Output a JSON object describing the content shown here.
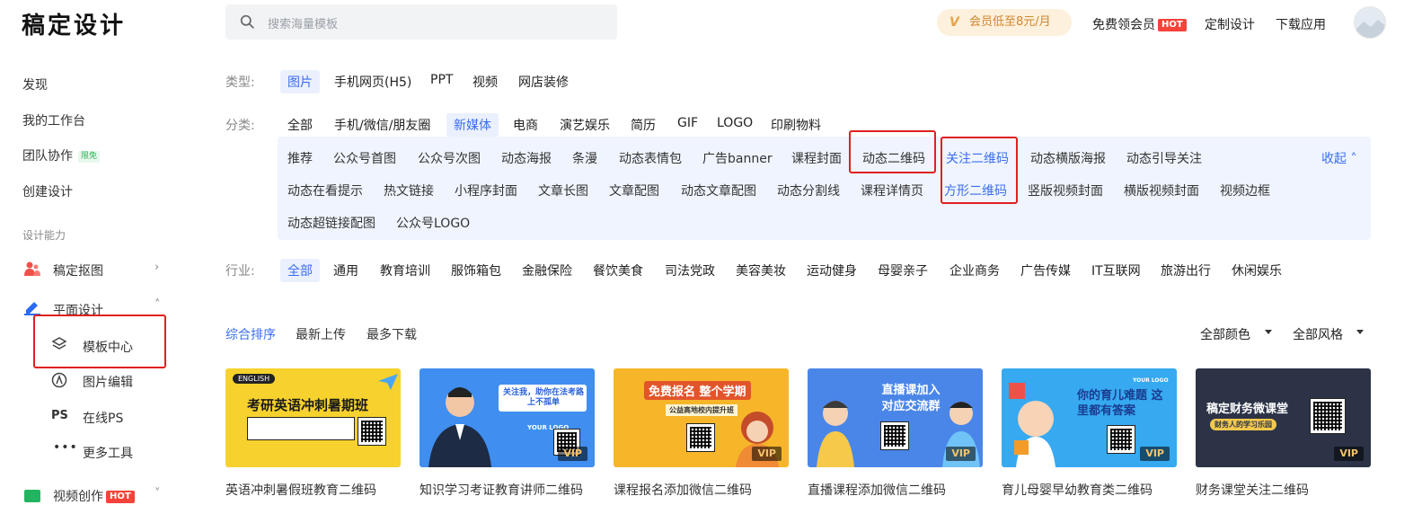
{
  "header": {
    "logo": "稿定设计",
    "search_placeholder": "搜索海量模板",
    "vip_icon": "V",
    "vip_text": "会员低至8元/月",
    "free_vip": "免费领会员",
    "hot": "HOT",
    "custom_design": "定制设计",
    "download_app": "下载应用"
  },
  "sidebar": {
    "discover": "发现",
    "workspace": "我的工作台",
    "team": "团队协作",
    "team_badge": "限免",
    "create": "创建设计",
    "section": "设计能力",
    "cutout": "稿定抠图",
    "graphic": "平面设计",
    "template_center": "模板中心",
    "image_edit": "图片编辑",
    "ps_icon": "PS",
    "online_ps": "在线PS",
    "more_tools": "更多工具",
    "video": "视频创作",
    "video_badge": "HOT"
  },
  "filters": {
    "type_label": "类型:",
    "types": [
      "图片",
      "手机网页(H5)",
      "PPT",
      "视频",
      "网店装修"
    ],
    "category_label": "分类:",
    "categories": [
      "全部",
      "手机/微信/朋友圈",
      "新媒体",
      "电商",
      "演艺娱乐",
      "简历",
      "GIF",
      "LOGO",
      "印刷物料"
    ],
    "sub_row1": [
      "推荐",
      "公众号首图",
      "公众号次图",
      "动态海报",
      "条漫",
      "动态表情包",
      "广告banner",
      "课程封面",
      "动态二维码",
      "关注二维码",
      "动态横版海报",
      "动态引导关注"
    ],
    "sub_row2": [
      "动态在看提示",
      "热文链接",
      "小程序封面",
      "文章长图",
      "文章配图",
      "动态文章配图",
      "动态分割线",
      "课程详情页",
      "方形二维码",
      "竖版视频封面",
      "横版视频封面",
      "视频边框"
    ],
    "sub_row3": [
      "动态超链接配图",
      "公众号LOGO"
    ],
    "collapse": "收起",
    "industry_label": "行业:",
    "industries": [
      "全部",
      "通用",
      "教育培训",
      "服饰箱包",
      "金融保险",
      "餐饮美食",
      "司法党政",
      "美容美妆",
      "运动健身",
      "母婴亲子",
      "企业商务",
      "广告传媒",
      "IT互联网",
      "旅游出行",
      "休闲娱乐"
    ]
  },
  "sort": {
    "options": [
      "综合排序",
      "最新上传",
      "最多下载"
    ],
    "color": "全部颜色",
    "style": "全部风格"
  },
  "cards": [
    {
      "title": "英语冲刺暑假班教育二维码",
      "headline": "考研英语冲刺暑期班",
      "tag": "ENGLISH",
      "bg": "#f7d22e"
    },
    {
      "title": "知识学习考证教育讲师二维码",
      "headline": "关注我，助你在法考路上不孤单",
      "tag": "YOUR LOGO",
      "bg": "#3f8ef0"
    },
    {
      "title": "课程报名添加微信二维码",
      "headline": "免费报名 整个学期",
      "tag": "公益高地校内提升班",
      "bg": "#f7b52a"
    },
    {
      "title": "直播课程添加微信二维码",
      "headline": "直播课加入 对应交流群",
      "tag": "",
      "bg": "#4a86e8"
    },
    {
      "title": "育儿母婴早幼教育类二维码",
      "headline": "你的育儿难题 这里都有答案",
      "tag": "YOUR LOGO",
      "bg": "#36a9f0"
    },
    {
      "title": "财务课堂关注二维码",
      "headline": "稿定财务微课堂",
      "tag": "财务人的学习乐园",
      "bg": "#2c3347"
    }
  ],
  "vip_badge": "VIP"
}
